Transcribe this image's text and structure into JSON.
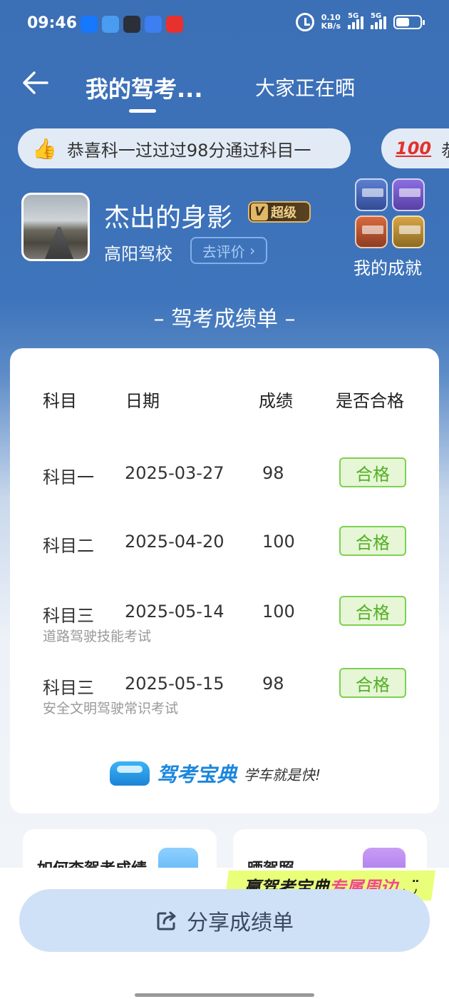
{
  "status_bar": {
    "time": "09:46",
    "speed_value": "0.10",
    "speed_unit": "KB/s",
    "net1": "5G",
    "net2": "5G"
  },
  "nav": {
    "tab_mine": "我的驾考...",
    "tab_all": "大家正在晒"
  },
  "ticker": [
    {
      "text": "恭喜科一过过过98分通过科目一"
    },
    {
      "text": "恭"
    }
  ],
  "profile": {
    "name": "杰出的身影",
    "vip_badge": "超级",
    "school": "高阳驾校",
    "rate_button": "去评价",
    "achievements_label": "我的成就"
  },
  "sheet_title": "– 驾考成绩单 –",
  "table": {
    "headers": [
      "科目",
      "日期",
      "成绩",
      "是否合格"
    ],
    "rows": [
      {
        "subject": "科目一",
        "date": "2025-03-27",
        "score": "98",
        "result": "合格",
        "note": ""
      },
      {
        "subject": "科目二",
        "date": "2025-04-20",
        "score": "100",
        "result": "合格",
        "note": ""
      },
      {
        "subject": "科目三",
        "date": "2025-05-14",
        "score": "100",
        "result": "合格",
        "note": "道路驾驶技能考试"
      },
      {
        "subject": "科目三",
        "date": "2025-05-15",
        "score": "98",
        "result": "合格",
        "note": "安全文明驾驶常识考试"
      }
    ]
  },
  "brand": {
    "name": "驾考宝典",
    "slogan": "学车就是快!"
  },
  "cards": [
    {
      "title": "如何查驾考成绩"
    },
    {
      "title": "晒驾照"
    }
  ],
  "promo": {
    "part1": "赢驾考宝典",
    "part2": "专属周边"
  },
  "share_button": "分享成绩单",
  "colors": {
    "primary": "#3b6fb6",
    "pass_green": "#54b024",
    "brand_blue": "#1b86dd"
  }
}
